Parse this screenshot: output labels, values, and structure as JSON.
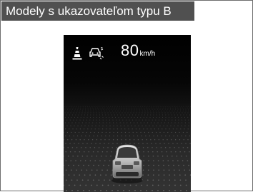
{
  "caption": {
    "label": "Modely s ukazovateľom typu B"
  },
  "display": {
    "speed_value": "80",
    "speed_unit": "km/h",
    "icons": {
      "lane_keep": "lane-keeping-assist-icon",
      "car_collision": "collision-warning-car-icon",
      "own_vehicle": "own-vehicle-rear-view-icon"
    }
  },
  "colors": {
    "caption_bg": "#505050",
    "caption_text": "#ffffff",
    "screen_bg": "#000000",
    "floor": "#2f2f2f",
    "text": "#ffffff"
  }
}
